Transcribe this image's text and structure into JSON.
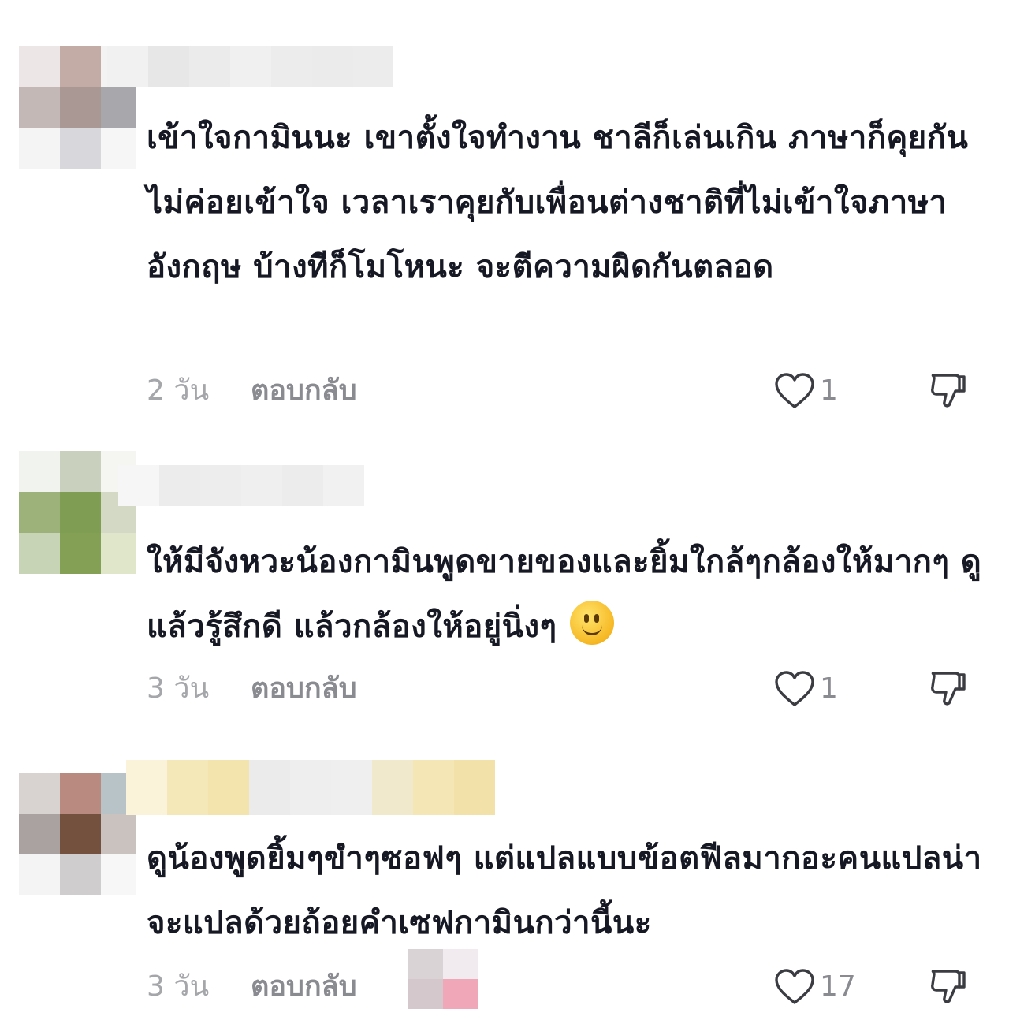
{
  "comments": [
    {
      "text": "เข้าใจกามินนะ เขาตั้งใจทำงาน ชาลีก็เล่นเกิน ภาษาก็คุยกันไม่ค่อยเข้าใจ เวลาเราคุยกับเพื่อนต่างชาติที่ไม่เข้าใจภาษาอังกฤษ บ้างทีก็โมโหนะ จะตีความผิดกันตลอด",
      "time": "2 วัน",
      "reply_label": "ตอบกลับ",
      "likes": "1"
    },
    {
      "text": "ให้มีจังหวะน้องกามินพูดขายของและยิ้มใกล้ๆกล้องให้มากๆ ดูแล้วรู้สึกดี แล้วกล้องให้อยู่นิ่งๆ",
      "time": "3 วัน",
      "reply_label": "ตอบกลับ",
      "likes": "1",
      "emoji": "slightly-smiling-face"
    },
    {
      "text": "ดูน้องพูดยิ้มๆขำๆซอฟๆ แต่แปลแบบข้อตฟีลมากอะคนแปลน่าจะแปลด้วยถ้อยคำเซฟกามินกว่านี้นะ",
      "time": "3 วัน",
      "reply_label": "ตอบกลับ",
      "likes": "17"
    }
  ],
  "colors": {
    "text": "#161823",
    "muted": "#a5a6aa",
    "reply": "#8a8b91",
    "icon": "#3b3c42"
  },
  "icons": {
    "like": "heart-outline-icon",
    "dislike": "thumbs-down-outline-icon"
  }
}
